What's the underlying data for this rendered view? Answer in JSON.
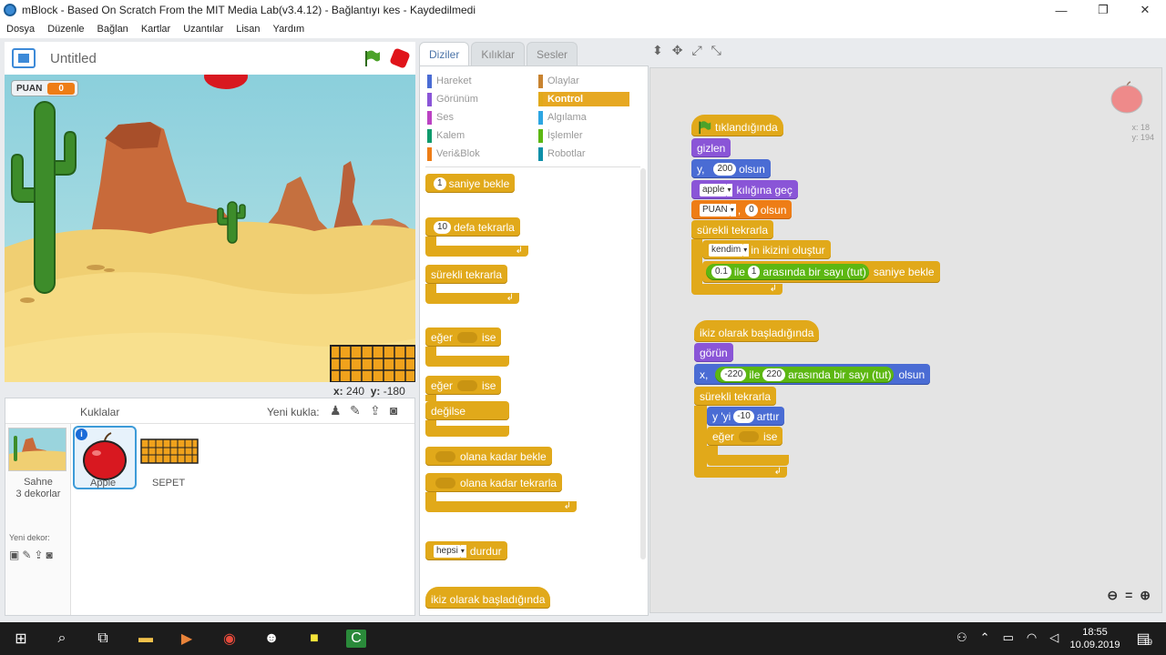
{
  "window": {
    "title": "mBlock - Based On Scratch From the MIT Media Lab(v3.4.12) - Bağlantıyı kes - Kaydedilmedi",
    "controls": [
      "—",
      "❐",
      "✕"
    ]
  },
  "menu": [
    "Dosya",
    "Düzenle",
    "Bağlan",
    "Kartlar",
    "Uzantılar",
    "Lisan",
    "Yardım"
  ],
  "stage": {
    "project_title": "Untitled",
    "score_label": "PUAN",
    "score_value": "0",
    "coords": {
      "x_label": "x:",
      "x": "240",
      "y_label": "y:",
      "y": "-180"
    }
  },
  "sprites": {
    "header": "Kuklalar",
    "new_sprite_label": "Yeni kukla:",
    "stage_name": "Sahne",
    "stage_backdrops": "3 dekorlar",
    "new_backdrop_label": "Yeni dekor:",
    "items": [
      "Apple",
      "SEPET"
    ]
  },
  "tabs": [
    "Diziler",
    "Kılıklar",
    "Sesler"
  ],
  "categories": [
    {
      "label": "Hareket",
      "color": "#4a6cd4"
    },
    {
      "label": "Görünüm",
      "color": "#8a55d7"
    },
    {
      "label": "Ses",
      "color": "#bb42c3"
    },
    {
      "label": "Kalem",
      "color": "#0e9a6c"
    },
    {
      "label": "Veri&Blok",
      "color": "#ee7d16"
    },
    {
      "label": "Olaylar",
      "color": "#c88330"
    },
    {
      "label": "Kontrol",
      "color": "#e1a91a"
    },
    {
      "label": "Algılama",
      "color": "#2ca5e2"
    },
    {
      "label": "İşlemler",
      "color": "#5cb712"
    },
    {
      "label": "Robotlar",
      "color": "#0c8fa8"
    }
  ],
  "palette": {
    "wait_num": "1",
    "wait": "saniye bekle",
    "repeat_num": "10",
    "repeat": "defa tekrarla",
    "forever": "sürekli tekrarla",
    "if": "eğer",
    "then": "ise",
    "else": "değilse",
    "wait_until": "olana kadar bekle",
    "repeat_until": "olana kadar tekrarla",
    "stop_opt": "hepsi",
    "stop": "durdur",
    "clone_start": "ikiz olarak başladığında"
  },
  "script1": {
    "flag_clicked": "tıklandığında",
    "hide": "gizlen",
    "sety_label": "y,",
    "sety_val": "200",
    "sety_suffix": "olsun",
    "costume_opt": "apple",
    "costume": "kılığına geç",
    "var_opt": "PUAN",
    "var_val": "0",
    "var_suffix": "olsun",
    "forever": "sürekli tekrarla",
    "clone_opt": "kendim",
    "clone": "in ikizini oluştur",
    "rand_min": "0.1",
    "rand_mid": "ile",
    "rand_max": "1",
    "rand_text": "arasında bir sayı (tut)",
    "rand_suffix": "saniye bekle"
  },
  "script2": {
    "clone_start": "ikiz olarak başladığında",
    "show": "görün",
    "setx_label": "x,",
    "setx_min": "-220",
    "setx_mid": "ile",
    "setx_max": "220",
    "setx_text": "arasında bir sayı (tut)",
    "setx_suffix": "olsun",
    "forever": "sürekli tekrarla",
    "change_label": "y 'yi",
    "change_val": "-10",
    "change_suffix": "arttır",
    "if": "eğer",
    "then": "ise"
  },
  "sprite_info": {
    "x_label": "x:",
    "x": "18",
    "y_label": "y:",
    "y": "194"
  },
  "taskbar": {
    "time": "18:55",
    "date": "10.09.2019",
    "notif": "19"
  }
}
